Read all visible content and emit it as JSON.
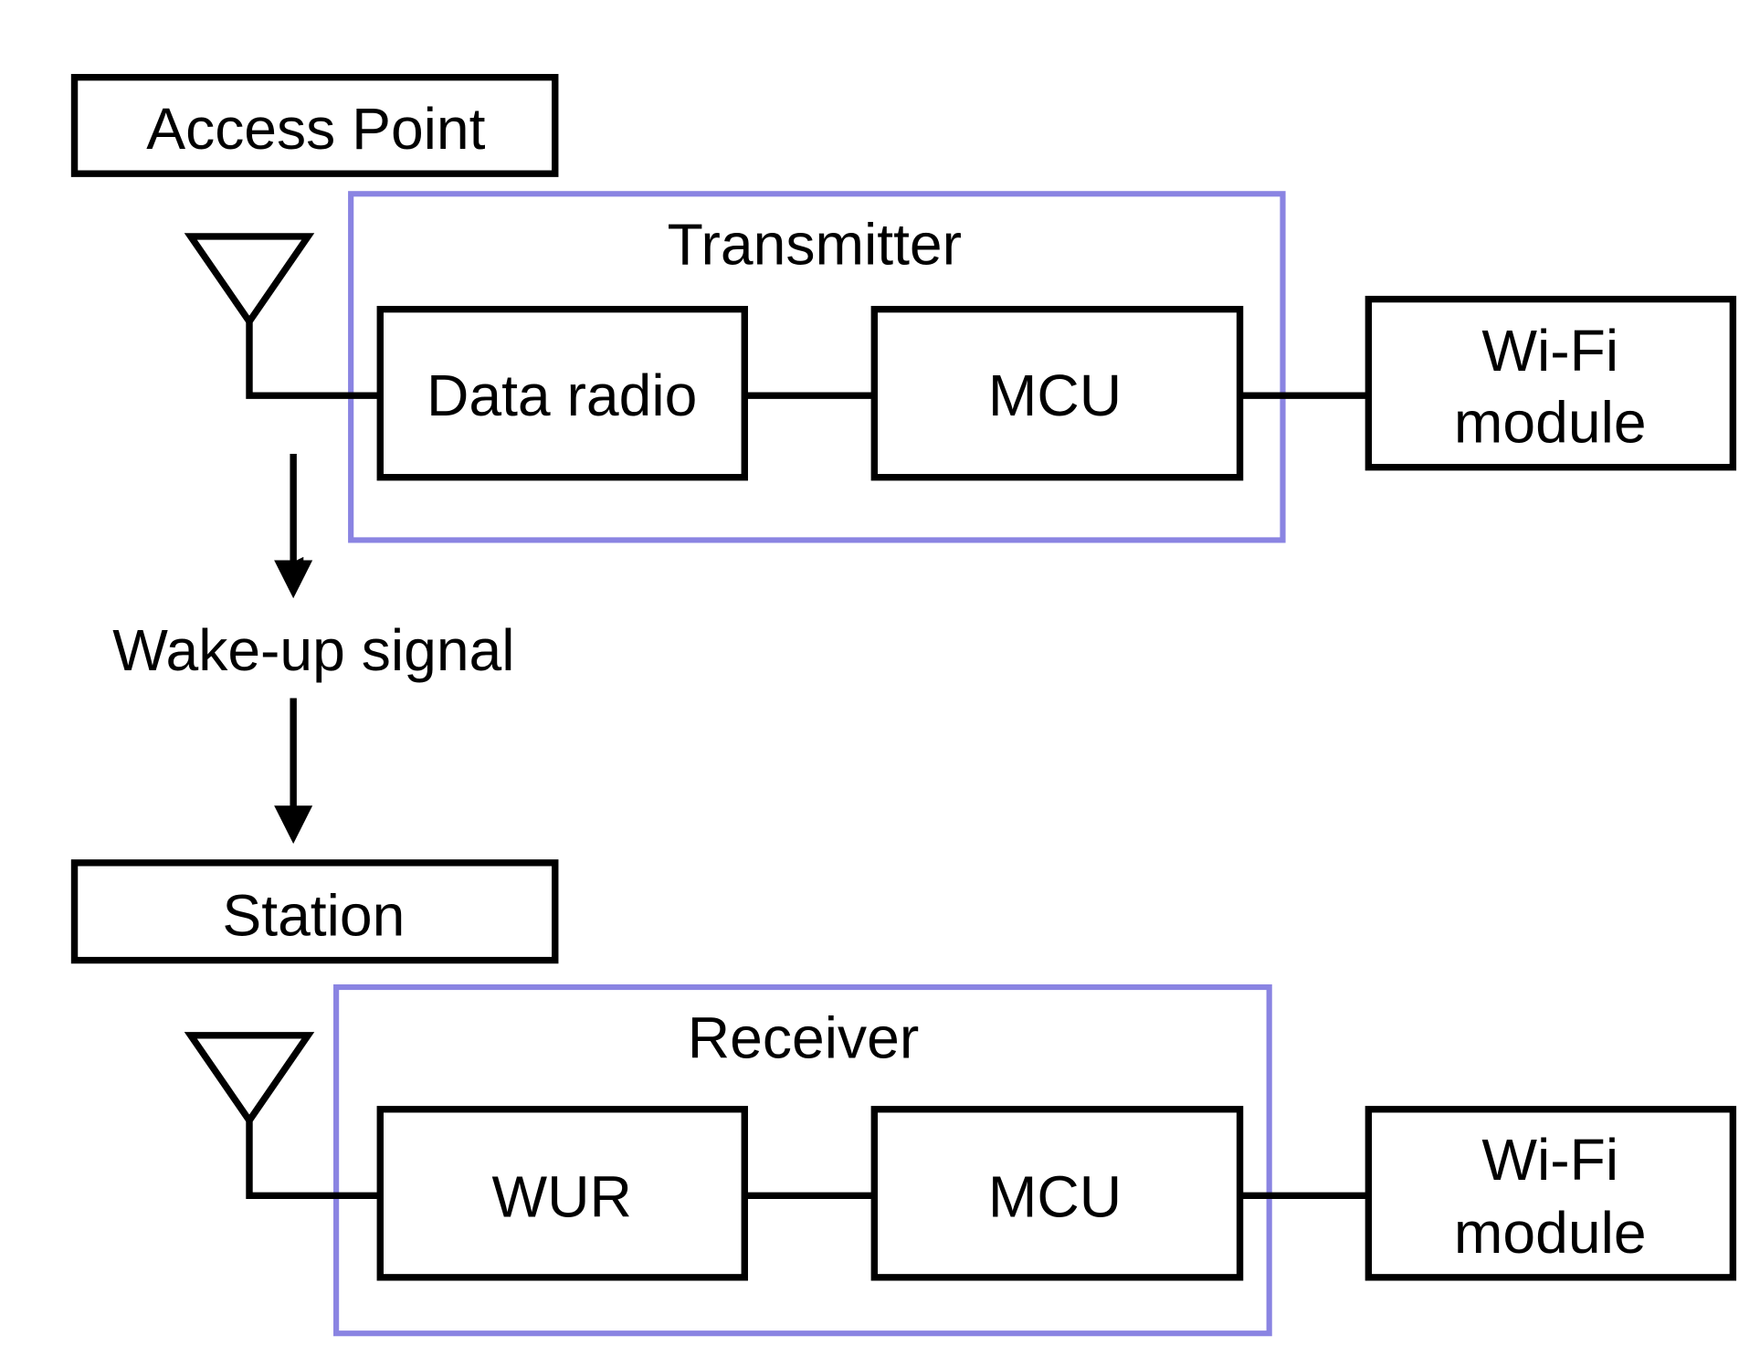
{
  "colors": {
    "group_border": "#8a84e2",
    "line": "#000000",
    "background": "#ffffff"
  },
  "access_point": {
    "label": "Access Point"
  },
  "transmitter": {
    "label": "Transmitter",
    "blocks": [
      {
        "label": "Data radio"
      },
      {
        "label": "MCU"
      }
    ],
    "external": {
      "line1": "Wi-Fi",
      "line2": "module"
    }
  },
  "signal": {
    "label": "Wake-up signal"
  },
  "station": {
    "label": "Station"
  },
  "receiver": {
    "label": "Receiver",
    "blocks": [
      {
        "label": "WUR"
      },
      {
        "label": "MCU"
      }
    ],
    "external": {
      "line1": "Wi-Fi",
      "line2": "module"
    }
  },
  "icons": {
    "antenna": "antenna-icon",
    "arrow": "arrow-down-icon"
  }
}
